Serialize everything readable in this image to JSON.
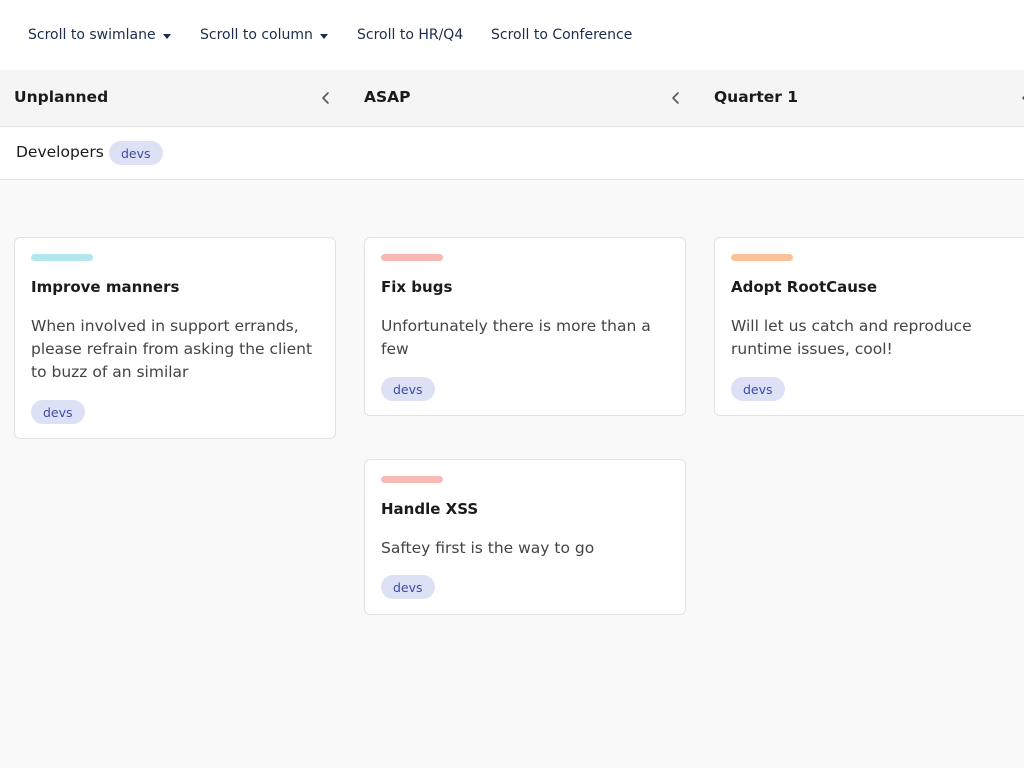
{
  "toolbar": {
    "scroll_to_swimlane": "Scroll to swimlane",
    "scroll_to_column": "Scroll to column",
    "scroll_to_hr_q4": "Scroll to HR/Q4",
    "scroll_to_conference": "Scroll to Conference"
  },
  "columns": [
    {
      "title": "Unplanned"
    },
    {
      "title": "ASAP"
    },
    {
      "title": "Quarter 1"
    }
  ],
  "swimlane": {
    "title": "Developers",
    "tag": "devs"
  },
  "cards": [
    {
      "title": "Improve manners",
      "description": "When involved in support errands, please refrain from asking the client to buzz of an similar",
      "tag": "devs",
      "color": "#b3e7ee"
    },
    {
      "title": "Fix bugs",
      "description": "Unfortunately there is more than a few",
      "tag": "devs",
      "color": "#f8b8b4"
    },
    {
      "title": "Adopt RootCause",
      "description": "Will let us catch and reproduce runtime issues, cool!",
      "tag": "devs",
      "color": "#fbc29a"
    },
    {
      "title": "Handle XSS",
      "description": "Saftey first is the way to go",
      "tag": "devs",
      "color": "#f8b8b4"
    }
  ],
  "colors": {
    "toolbar_text": "#1c2c4c",
    "tag_background": "#dde1f6",
    "tag_text": "#3b4aa8",
    "board_background": "#f9f9f9"
  },
  "icons": {
    "dropdown": "caret-down-icon",
    "collapse": "chevron-left-icon"
  }
}
